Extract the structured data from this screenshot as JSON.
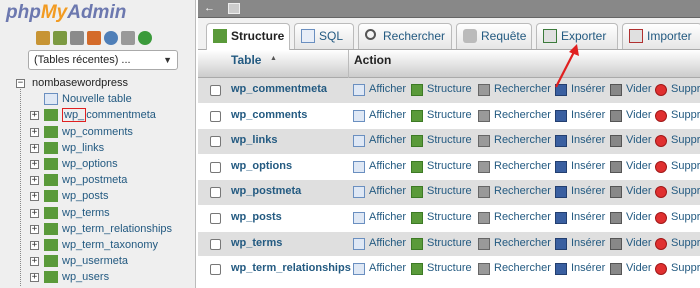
{
  "sidebar": {
    "logo": {
      "php": "php",
      "my": "My",
      "admin": "Admin"
    },
    "nav_icons": [
      "home-icon",
      "exit-icon",
      "query-window-icon",
      "docs-icon",
      "help-icon",
      "settings-icon",
      "reload-icon"
    ],
    "recent_select": {
      "value": "(Tables récentes) ..."
    },
    "tree": {
      "database": "nombasewordpress",
      "new_table": "Nouvelle table",
      "tables": [
        "wp_commentmeta",
        "wp_comments",
        "wp_links",
        "wp_options",
        "wp_postmeta",
        "wp_posts",
        "wp_terms",
        "wp_term_relationships",
        "wp_term_taxonomy",
        "wp_usermeta",
        "wp_users"
      ],
      "highlighted_prefix": "wp_",
      "highlighted_rest": "commentmeta"
    }
  },
  "topbar": {
    "arrow": "←"
  },
  "tabs": [
    {
      "label": "Structure",
      "active": true
    },
    {
      "label": "SQL",
      "active": false
    },
    {
      "label": "Rechercher",
      "active": false
    },
    {
      "label": "Requête",
      "active": false
    },
    {
      "label": "Exporter",
      "active": false
    },
    {
      "label": "Importer",
      "active": false
    }
  ],
  "table": {
    "headers": {
      "table": "Table",
      "sort": "▲",
      "action": "Action"
    },
    "rows": [
      "wp_commentmeta",
      "wp_comments",
      "wp_links",
      "wp_options",
      "wp_postmeta",
      "wp_posts",
      "wp_terms",
      "wp_term_relationships"
    ],
    "actions": {
      "browse": "Afficher",
      "structure": "Structure",
      "search": "Rechercher",
      "insert": "Insérer",
      "empty": "Vider",
      "drop": "Supprimer"
    }
  },
  "colors": {
    "link": "#235a81",
    "annotation": "#e02020",
    "row_alt": "#dfdfdf"
  }
}
